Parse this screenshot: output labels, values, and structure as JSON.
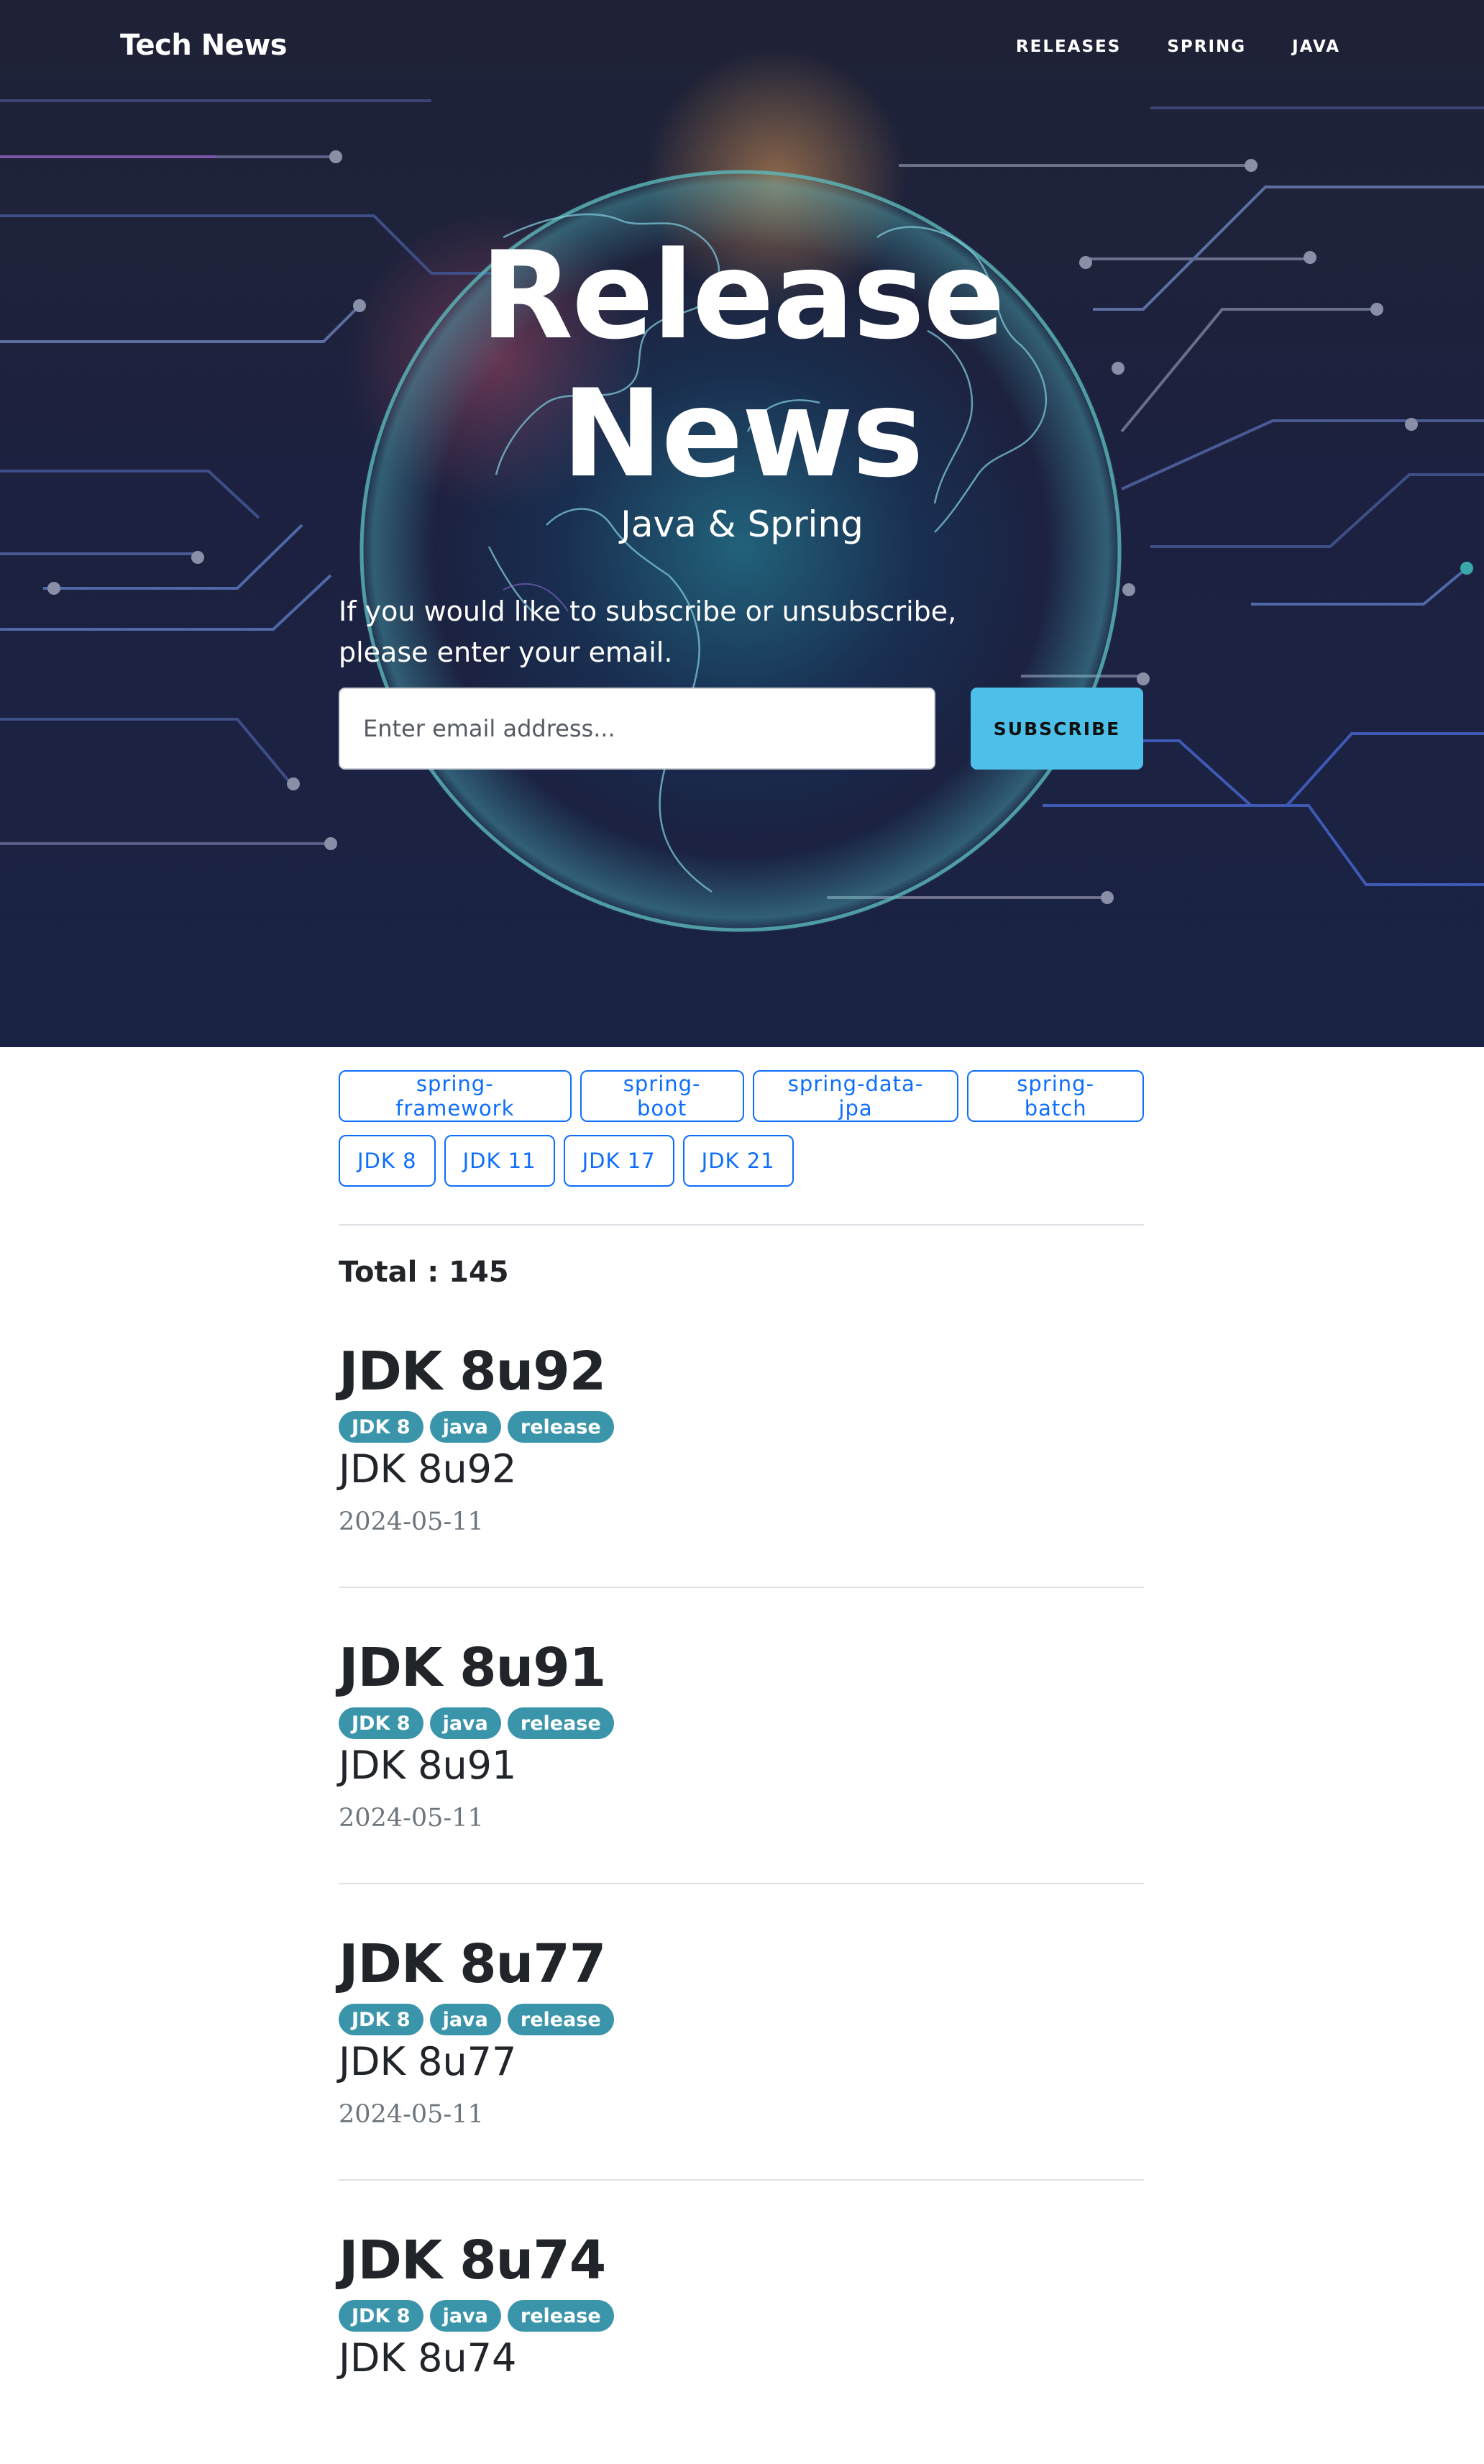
{
  "header": {
    "brand": "Tech News",
    "nav": [
      "RELEASES",
      "SPRING",
      "JAVA"
    ]
  },
  "hero": {
    "title_line1": "Release",
    "title_line2": "News",
    "subtitle": "Java & Spring",
    "subscribe_line1": "If you would like to subscribe or unsubscribe,",
    "subscribe_line2": "please enter your email.",
    "email_placeholder": "Enter email address...",
    "subscribe_button": "SUBSCRIBE"
  },
  "filters": {
    "row1": [
      "spring-framework",
      "spring-boot",
      "spring-data-jpa",
      "spring-batch"
    ],
    "row2": [
      "JDK 8",
      "JDK 11",
      "JDK 17",
      "JDK 21"
    ]
  },
  "total": "Total : 145",
  "posts": [
    {
      "title": "JDK 8u92",
      "tags": [
        "JDK 8",
        "java",
        "release"
      ],
      "subtitle": "JDK 8u92",
      "date": "2024-05-11"
    },
    {
      "title": "JDK 8u91",
      "tags": [
        "JDK 8",
        "java",
        "release"
      ],
      "subtitle": "JDK 8u91",
      "date": "2024-05-11"
    },
    {
      "title": "JDK 8u77",
      "tags": [
        "JDK 8",
        "java",
        "release"
      ],
      "subtitle": "JDK 8u77",
      "date": "2024-05-11"
    },
    {
      "title": "JDK 8u74",
      "tags": [
        "JDK 8",
        "java",
        "release"
      ],
      "subtitle": "JDK 8u74",
      "date": ""
    }
  ],
  "colors": {
    "accent_button": "#4dc0ea",
    "tag_outline": "#0d6efd",
    "badge": "#3a95ab",
    "hero_bg": "#1c2140"
  }
}
